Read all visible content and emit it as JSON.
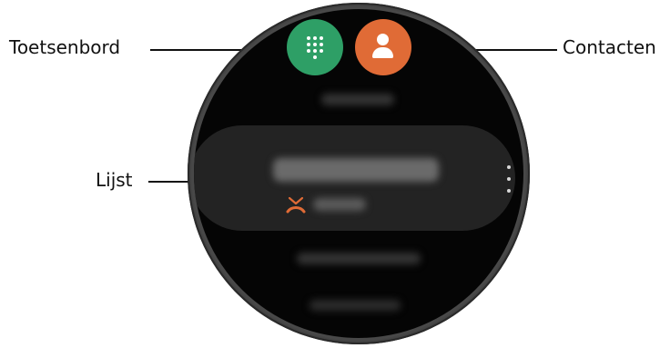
{
  "callouts": {
    "keypad": "Toetsenbord",
    "contacts": "Contacten",
    "list": "Lijst"
  },
  "icons": {
    "keypad": "dialpad-icon",
    "contacts": "person-icon",
    "missed_call": "missed-call-icon",
    "more": "more-options-icon"
  },
  "colors": {
    "keypad_button": "#2e9f66",
    "contacts_button": "#e06b36",
    "missed_call": "#e06b36",
    "screen": "#050505"
  }
}
